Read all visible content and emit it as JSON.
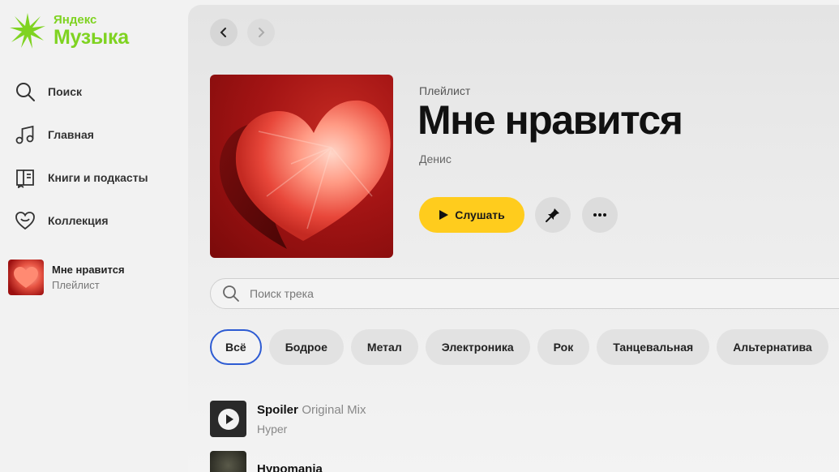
{
  "app": {
    "logo_small": "Яндекс",
    "logo_big": "Музыка",
    "brand_color": "#7fd321",
    "accent_color": "#ffcc1d",
    "selection_color": "#2d5bd3"
  },
  "sidebar": {
    "items": [
      {
        "label": "Поиск",
        "icon": "search-icon"
      },
      {
        "label": "Главная",
        "icon": "music-note-icon"
      },
      {
        "label": "Книги и подкасты",
        "icon": "book-icon"
      },
      {
        "label": "Коллекция",
        "icon": "heart-icon"
      }
    ],
    "playlist": {
      "title": "Мне нравится",
      "subtitle": "Плейлист"
    }
  },
  "header": {
    "type": "Плейлист",
    "title": "Мне нравится",
    "owner": "Денис"
  },
  "actions": {
    "play_label": "Слушать",
    "pin_icon": "pin-icon",
    "more_icon": "more-icon"
  },
  "search": {
    "placeholder": "Поиск трека",
    "value": ""
  },
  "filters": {
    "chips": [
      "Всё",
      "Бодрое",
      "Метал",
      "Электроника",
      "Рок",
      "Танцевальная",
      "Альтернатива"
    ],
    "selected": "Всё"
  },
  "tracks": [
    {
      "title": "Spoiler",
      "version": "Original Mix",
      "artist": "Hyper"
    },
    {
      "title": "Hypomania",
      "version": "",
      "artist": ""
    }
  ]
}
